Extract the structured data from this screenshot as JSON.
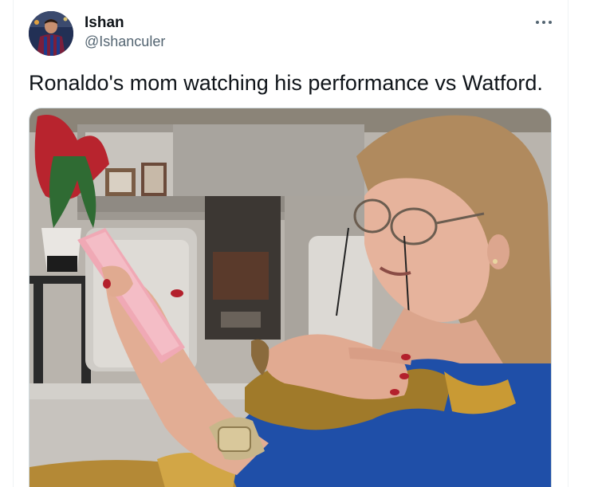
{
  "tweet": {
    "author": {
      "display_name": "Ishan",
      "handle": "@Ishanculer",
      "avatar_icon": "profile-avatar"
    },
    "more_icon": "more-options-icon",
    "text": "Ronaldo's mom watching his performance vs Watford.",
    "media": {
      "kind": "photo",
      "icon": "tweet-photo"
    }
  },
  "colors": {
    "text_primary": "#0f1419",
    "text_secondary": "#536471",
    "border": "#cfd9de",
    "background": "#ffffff"
  }
}
